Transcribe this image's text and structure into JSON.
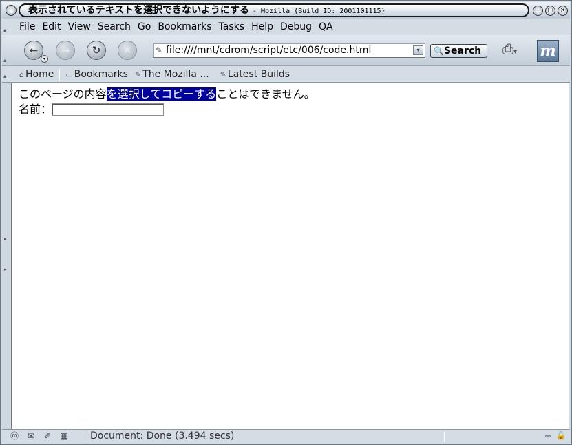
{
  "window": {
    "title": "表示されているテキストを選択できないようにする",
    "title_suffix": "- Mozilla {Build ID: 2001101115}"
  },
  "menubar": {
    "items": [
      "File",
      "Edit",
      "View",
      "Search",
      "Go",
      "Bookmarks",
      "Tasks",
      "Help",
      "Debug",
      "QA"
    ]
  },
  "navbar": {
    "url": "file:////mnt/cdrom/script/etc/006/code.html",
    "search_label": "Search",
    "icons": {
      "back": "back-arrow-icon",
      "forward": "forward-arrow-icon",
      "reload": "reload-icon",
      "stop": "stop-icon",
      "print": "print-icon",
      "brand": "mozilla-logo"
    }
  },
  "personal_toolbar": {
    "items": [
      "Home",
      "Bookmarks",
      "The Mozilla ...",
      "Latest Builds"
    ]
  },
  "content": {
    "line1_before": "このページの内容",
    "line1_selected": "を選択してコピーする",
    "line1_after": "ことはできません。",
    "name_label": "名前：",
    "name_value": ""
  },
  "statusbar": {
    "text": "Document: Done (3.494 secs)"
  },
  "colors": {
    "selection": "#00009c",
    "chrome": "#d4dce4"
  }
}
